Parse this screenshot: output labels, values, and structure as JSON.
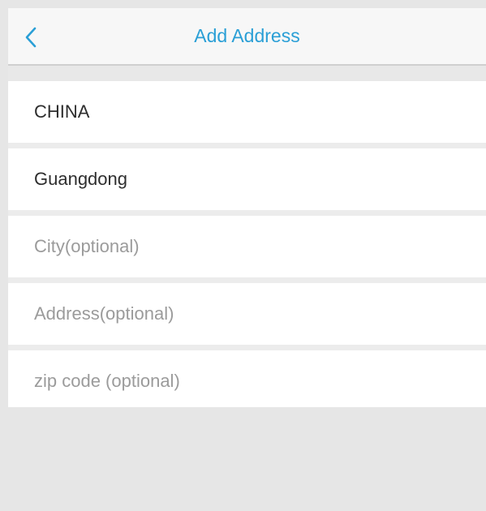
{
  "nav": {
    "title": "Add Address",
    "back_icon": "chevron-left-icon",
    "accent_color": "#2a9fd6"
  },
  "form": {
    "country": "CHINA",
    "province": "Guangdong",
    "city_placeholder": "City(optional)",
    "address_placeholder": "Address(optional)",
    "zip_placeholder": "zip code (optional)"
  }
}
